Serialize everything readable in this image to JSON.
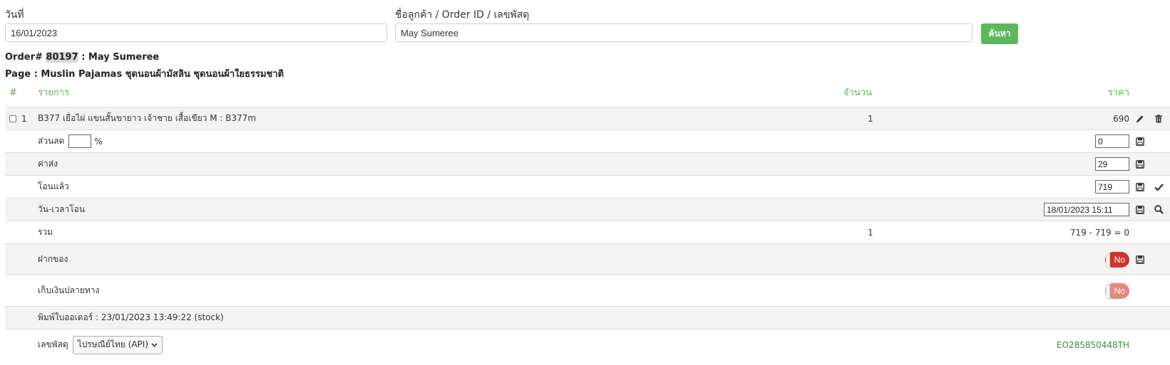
{
  "search": {
    "date_label": "วันที่",
    "date_value": "16/01/2023",
    "query_label": "ชื่อลูกค้า / Order ID / เลขพัสดุ",
    "query_value": "May Sumeree",
    "search_button": "ค้นหา"
  },
  "order": {
    "prefix": "Order#",
    "id": "80197",
    "customer": ": May Sumeree",
    "page_line": "Page : Muslin Pajamas ชุดนอนผ้ามัสลิน ชุดนอนผ้าใยธรรมชาติ"
  },
  "table": {
    "headers": {
      "index": "#",
      "item": "รายการ",
      "qty": "จำนวน",
      "price": "ราคา"
    },
    "item": {
      "index": "1",
      "name": "B377 เยื่อไผ่ แขนสั้นขายาว เจ้าชาย เสื้อเขียว M : B377m",
      "qty": "1",
      "price": "690"
    },
    "discount": {
      "label": "ส่วนลด",
      "percent_value": "",
      "percent_sign": "%",
      "value": "0"
    },
    "shipping": {
      "label": "ค่าส่ง",
      "value": "29"
    },
    "transferred": {
      "label": "โอนแล้ว",
      "value": "719"
    },
    "transfer_time": {
      "label": "วัน-เวลาโอน",
      "value": "18/01/2023 15:11"
    },
    "total": {
      "label": "รวม",
      "qty": "1",
      "value": "719 - 719 = 0"
    },
    "deposit": {
      "label": "ฝากของ",
      "toggle": "No"
    },
    "cod": {
      "label": "เก็บเงินปลายทาง",
      "toggle": "No"
    },
    "printed": {
      "label": "พิมพ์ใบออเดอร์ : 23/01/2023 13:49:22 (stock)"
    },
    "tracking": {
      "label": "เลขพัสดุ",
      "carrier": "ไปรษณีย์ไทย (API)",
      "number": "EO285850448TH"
    }
  },
  "colors": {
    "accent": "#5cb85c",
    "toggle_no": "#d0342c",
    "tracking": "#3c8d3c"
  }
}
